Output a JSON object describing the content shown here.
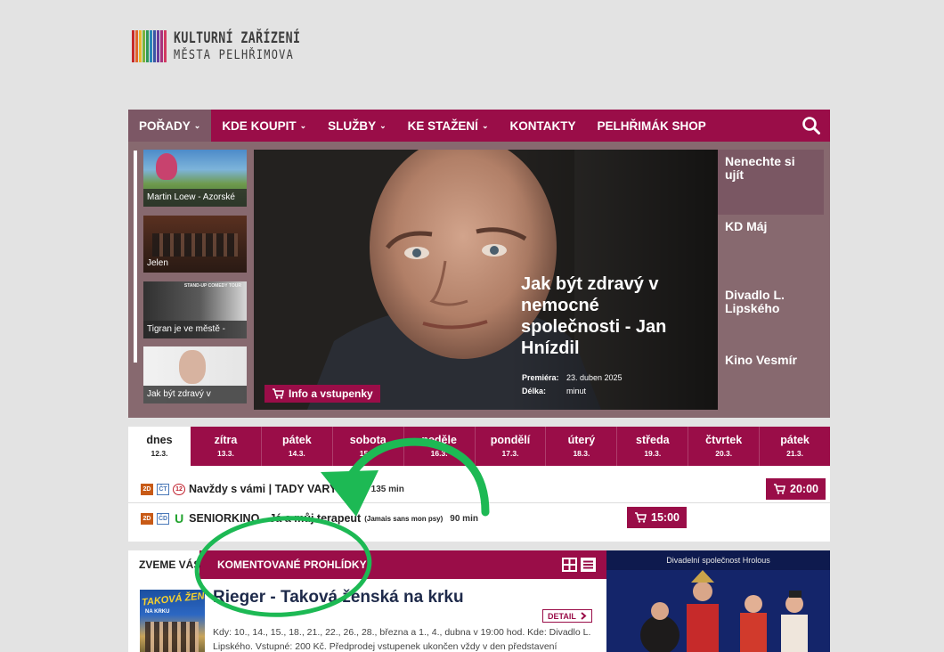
{
  "logo": {
    "line1": "KULTURNÍ ZAŘÍZENÍ",
    "line2": "MĚSTA PELHŘIMOVA",
    "bar_colors": [
      "#c62a2a",
      "#e0632b",
      "#e9b72e",
      "#7ab33c",
      "#2f9a5a",
      "#2a86b8",
      "#3b55a6",
      "#6a3c9c",
      "#a8327d",
      "#d23a62"
    ]
  },
  "nav": {
    "items": [
      {
        "label": "POŘADY",
        "chevron": "⌄"
      },
      {
        "label": "KDE KOUPIT",
        "chevron": "⌄"
      },
      {
        "label": "SLUŽBY",
        "chevron": "⌄"
      },
      {
        "label": "KE STAŽENÍ",
        "chevron": "⌄"
      },
      {
        "label": "KONTAKTY",
        "chevron": ""
      },
      {
        "label": "PELHŘIMÁK SHOP",
        "chevron": ""
      }
    ],
    "search_icon": "search-icon"
  },
  "hero": {
    "thumbs": [
      {
        "caption": "Martin Loew - Azorské"
      },
      {
        "caption": "Jelen"
      },
      {
        "caption": "Tigran je ve městě -"
      },
      {
        "caption": "Jak být zdravý v"
      }
    ],
    "thumb_overlay_text": "STAND-UP COMEDY TOUR",
    "title": "Jak být zdravý v nemocné společnosti - Jan Hnízdil",
    "premiere_label": "Premiéra:",
    "premiere_value": "23. duben 2025",
    "length_label": "Délka:",
    "length_value": "minut",
    "info_button": "Info a vstupenky",
    "side_menu": [
      "Nenechte si ujít",
      "KD Máj",
      "Divadlo L. Lipského",
      "Kino Vesmír"
    ]
  },
  "schedule": {
    "tabs": [
      {
        "day": "dnes",
        "date": "12.3."
      },
      {
        "day": "zítra",
        "date": "13.3."
      },
      {
        "day": "pátek",
        "date": "14.3."
      },
      {
        "day": "sobota",
        "date": "15.3."
      },
      {
        "day": "neděle",
        "date": "16.3."
      },
      {
        "day": "pondělí",
        "date": "17.3."
      },
      {
        "day": "úterý",
        "date": "18.3."
      },
      {
        "day": "středa",
        "date": "19.3."
      },
      {
        "day": "čtvrtek",
        "date": "20.3."
      },
      {
        "day": "pátek",
        "date": "21.3."
      }
    ],
    "rows": [
      {
        "badge_format": "2D",
        "badge_lang": "ČT",
        "badge_age": "12",
        "title": "Navždy s vámi | TADY VARY",
        "original": "( I'm St",
        "duration": "135 min",
        "time": "20:00"
      },
      {
        "badge_format": "2D",
        "badge_lang": "ČD",
        "badge_age": "U",
        "title": "SENIORKINO - Já a můj terapeut",
        "original": "(Jamais sans mon psy)",
        "duration": "90 min",
        "time": "15:00"
      }
    ]
  },
  "bottom": {
    "tab_active": "ZVEME VÁS",
    "tab_other": "KOMENTOVANÉ PROHLÍDKY",
    "poster_text": "TAKOVÁ ŽENSKÁ",
    "poster_top": "NA KRKU",
    "article_title": "Rieger - Taková ženská na krku",
    "detail_button": "DETAIL",
    "article_text": "Kdy: 10., 14., 15., 18., 21., 22., 26., 28., března a 1., 4., dubna v 19:00 hod. Kde: Divadlo L. Lipského. Vstupné: 200 Kč. Předprodej vstupenek ukončen vždy v den představení",
    "right_caption": "Divadelní společnost Hrolous"
  },
  "colors": {
    "brand": "#9a0d48",
    "hero_bg": "#87696f",
    "annotation": "#1db954"
  }
}
